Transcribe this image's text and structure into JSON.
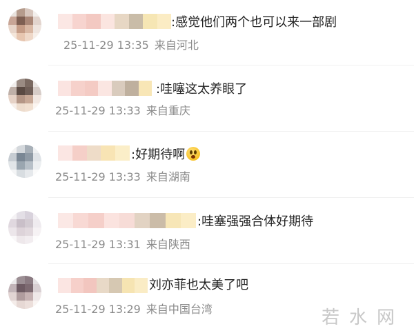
{
  "comments": [
    {
      "text": ":感觉他们两个也可以来一部剧",
      "date": "25-11-29 13:35",
      "location": "来自河北",
      "avatar_icon": "pixelated-avatar-icon",
      "colors": {
        "avatar": [
          "#e9e3de",
          "#b59b8c",
          "#d7c6bd",
          "#f3efec",
          "#c8a596",
          "#7e5f52",
          "#a98676",
          "#e2d4cd",
          "#e8d5c9",
          "#c59c86",
          "#d9b8a4",
          "#efe5df",
          "#f4e6da",
          "#e7c6b0",
          "#efd8c8",
          "#f7efe9"
        ],
        "name": [
          "#fbe7e4",
          "#f7d4cf",
          "#f3c9c2",
          "#fbe5e0",
          "#e7d7c4",
          "#c9bca8",
          "#f6e6b4",
          "#fbecc4"
        ]
      }
    },
    {
      "text": ":哇噻这太养眼了",
      "date": "25-11-29 13:33",
      "location": "来自重庆",
      "avatar_icon": "pixelated-avatar-icon",
      "colors": {
        "avatar": [
          "#f1eeec",
          "#9a8b83",
          "#7a6961",
          "#e9e4e1",
          "#bfb0a8",
          "#5a4a43",
          "#6e5d56",
          "#d6ccc7",
          "#e6d2c6",
          "#b49686",
          "#c7a896",
          "#f2e8e2",
          "#f7efe9",
          "#eddccd",
          "#f1e0d1",
          "#fbf5f0"
        ],
        "name": [
          "#fbe4e1",
          "#f6d1cb",
          "#f4cbc4",
          "#fbe6e2",
          "#d9cbbd",
          "#bfb09e",
          "#f8e6b6"
        ]
      }
    },
    {
      "text": ":好期待啊",
      "date": "25-11-29 13:33",
      "location": "来自湖南",
      "avatar_icon": "pixelated-avatar-icon",
      "emoji_icon": "surprised-face-emoji-icon",
      "colors": {
        "avatar": [
          "#f2f2f2",
          "#d4d8dc",
          "#a8b0b8",
          "#eef0f2",
          "#c6ccd2",
          "#7a8794",
          "#8f9aa5",
          "#dfe3e7",
          "#e1e5e8",
          "#9aa6b0",
          "#b7c0c8",
          "#eceff1",
          "#f4f5f6",
          "#d8dde1",
          "#e6e9ec",
          "#fafafa"
        ],
        "name": [
          "#fbe6e3",
          "#f5cfc8",
          "#eedcc8",
          "#f8e4b4",
          "#fbeec8"
        ]
      }
    },
    {
      "text": ":哇塞强强合体好期待",
      "date": "25-11-29 13:31",
      "location": "来自陕西",
      "avatar_icon": "pixelated-avatar-icon",
      "colors": {
        "avatar": [
          "#f5f3f5",
          "#e3dfe6",
          "#d8d2dc",
          "#f2eff3",
          "#e0d8df",
          "#c9bfc8",
          "#d3cbd2",
          "#efebef",
          "#ece6ea",
          "#ddd3d9",
          "#e2d9de",
          "#f6f2f4",
          "#faf8f9",
          "#eee8eb",
          "#f2edf0",
          "#fdfcfc"
        ],
        "name": [
          "#fbe8e5",
          "#f8d9d4",
          "#f5cfc9",
          "#fbe3df",
          "#f7dcd7",
          "#e2d3c3",
          "#cbbca8",
          "#f7e6b7",
          "#fbedc6"
        ]
      }
    },
    {
      "text": "刘亦菲也太美了吧",
      "date": "25-11-29 13:29",
      "location": "来自中国台湾",
      "avatar_icon": "pixelated-avatar-icon",
      "colors": {
        "avatar": [
          "#ebe9ea",
          "#9c8f94",
          "#8b7b82",
          "#e4e0e2",
          "#c2b4b8",
          "#6e5b63",
          "#7d6a71",
          "#d8cfd2",
          "#e2d4d3",
          "#b09c9e",
          "#c6b2b3",
          "#efe8e8",
          "#f4ece9",
          "#e6d8d4",
          "#ecdfdb",
          "#f9f4f2"
        ],
        "name": [
          "#fbe5e2",
          "#f6d0ca",
          "#f2c6bf",
          "#e8d9c7",
          "#d6c8b2",
          "#f6e4b2",
          "#faecc5"
        ]
      }
    }
  ],
  "watermark": "若水网"
}
